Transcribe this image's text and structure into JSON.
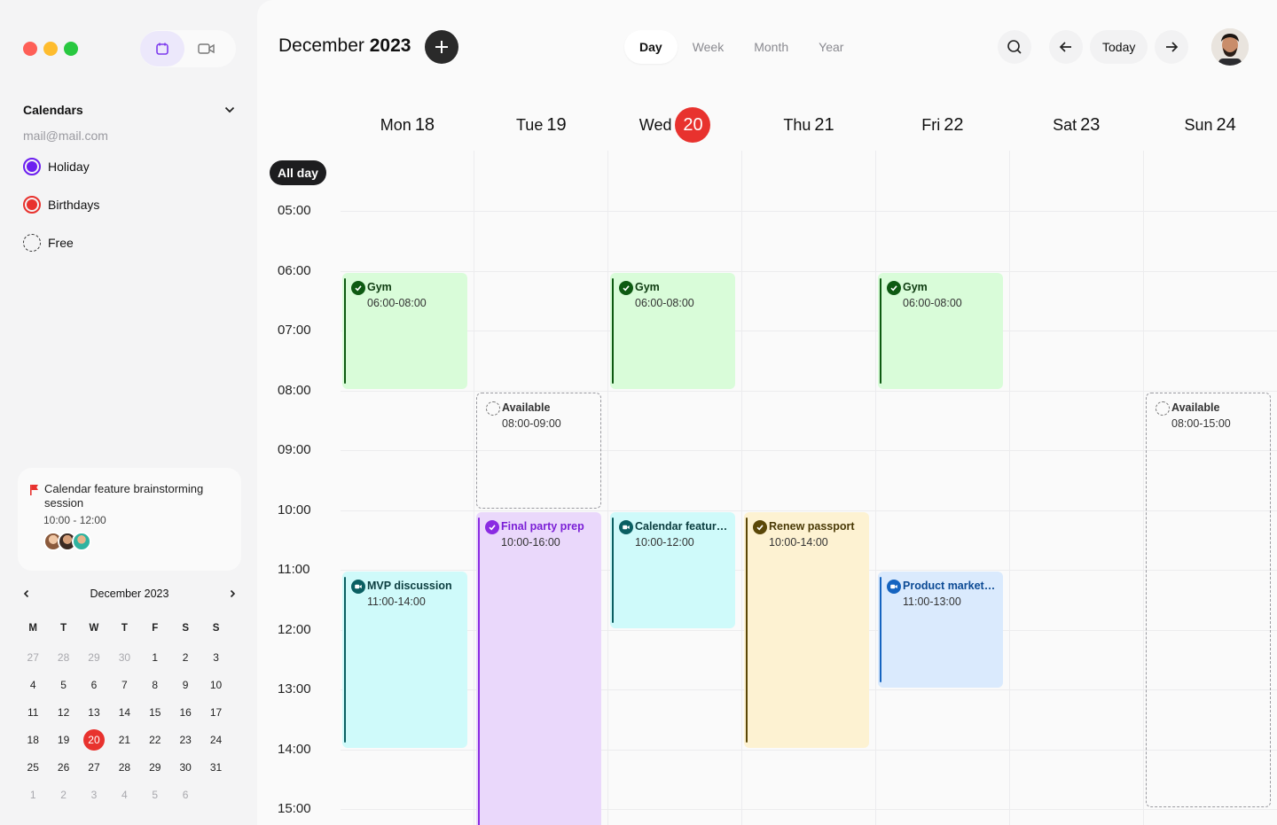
{
  "window": {
    "traffic_colors": [
      "#fe5f57",
      "#febc2e",
      "#28c840"
    ]
  },
  "sidebar": {
    "calendars_label": "Calendars",
    "email": "mail@mail.com",
    "calendars": [
      {
        "label": "Holiday",
        "color": "#6c1ff0"
      },
      {
        "label": "Birthdays",
        "color": "#e8322e"
      },
      {
        "label": "Free",
        "color": ""
      }
    ],
    "event_card": {
      "title": "Calendar feature brainstorming session",
      "time": "10:00 - 12:00",
      "flag_color": "#e8322e"
    },
    "mini_calendar": {
      "month": "December 2023",
      "dow": [
        "M",
        "T",
        "W",
        "T",
        "F",
        "S",
        "S"
      ],
      "weeks": [
        [
          "27",
          "28",
          "29",
          "30",
          "1",
          "2",
          "3"
        ],
        [
          "4",
          "5",
          "6",
          "7",
          "8",
          "9",
          "10"
        ],
        [
          "11",
          "12",
          "13",
          "14",
          "15",
          "16",
          "17"
        ],
        [
          "18",
          "19",
          "20",
          "21",
          "22",
          "23",
          "24"
        ],
        [
          "25",
          "26",
          "27",
          "28",
          "29",
          "30",
          "31"
        ],
        [
          "1",
          "2",
          "3",
          "4",
          "5",
          "6"
        ]
      ],
      "today": "20"
    }
  },
  "header": {
    "month": "December",
    "year": "2023",
    "add_icon": "plus-icon",
    "views": [
      "Day",
      "Week",
      "Month",
      "Year"
    ],
    "active_view": "Day",
    "today_label": "Today"
  },
  "days": [
    {
      "name": "Mon",
      "num": "18"
    },
    {
      "name": "Tue",
      "num": "19"
    },
    {
      "name": "Wed",
      "num": "20",
      "today": true
    },
    {
      "name": "Thu",
      "num": "21"
    },
    {
      "name": "Fri",
      "num": "22"
    },
    {
      "name": "Sat",
      "num": "23"
    },
    {
      "name": "Sun",
      "num": "24"
    }
  ],
  "allday_label": "All day",
  "hours": [
    "05:00",
    "06:00",
    "07:00",
    "08:00",
    "09:00",
    "10:00",
    "11:00",
    "12:00",
    "13:00",
    "14:00",
    "15:00"
  ],
  "events": [
    {
      "day": 0,
      "title": "Gym",
      "time": "06:00-08:00",
      "start": 6,
      "end": 8,
      "kind": "check",
      "bg": "#d9fcd9",
      "accent": "#0e5a12",
      "text": "#0e3b10"
    },
    {
      "day": 2,
      "title": "Gym",
      "time": "06:00-08:00",
      "start": 6,
      "end": 8,
      "kind": "check",
      "bg": "#d9fcd9",
      "accent": "#0e5a12",
      "text": "#0e3b10"
    },
    {
      "day": 4,
      "title": "Gym",
      "time": "06:00-08:00",
      "start": 6,
      "end": 8,
      "kind": "check",
      "bg": "#d9fcd9",
      "accent": "#0e5a12",
      "text": "#0e3b10"
    },
    {
      "day": 1,
      "title": "Available",
      "time": "08:00-09:00",
      "start": 8,
      "end": 10,
      "kind": "dash",
      "text": "#333"
    },
    {
      "day": 6,
      "title": "Available",
      "time": "08:00-15:00",
      "start": 8,
      "end": 15,
      "kind": "dash",
      "text": "#333"
    },
    {
      "day": 1,
      "title": "Final party prep",
      "time": "10:00-16:00",
      "start": 10,
      "end": 16,
      "kind": "check",
      "bg": "#ead8fb",
      "accent": "#8a2be2",
      "text": "#7b1fd6"
    },
    {
      "day": 2,
      "title": "Calendar feature...",
      "time": "10:00-12:00",
      "start": 10,
      "end": 12,
      "kind": "video",
      "bg": "#cffafa",
      "accent": "#0b5f62",
      "text": "#0b3d3f"
    },
    {
      "day": 3,
      "title": "Renew passport",
      "time": "10:00-14:00",
      "start": 10,
      "end": 14,
      "kind": "check",
      "bg": "#fdf2d2",
      "accent": "#5a4708",
      "text": "#4a3a06"
    },
    {
      "day": 0,
      "title": "MVP discussion",
      "time": "11:00-14:00",
      "start": 11,
      "end": 14,
      "kind": "video",
      "bg": "#cffafa",
      "accent": "#0b5f62",
      "text": "#0b3d3f"
    },
    {
      "day": 4,
      "title": "Product market fi...",
      "time": "11:00-13:00",
      "start": 11,
      "end": 13,
      "kind": "video",
      "bg": "#daeafd",
      "accent": "#1564c0",
      "text": "#0c4a94"
    }
  ]
}
